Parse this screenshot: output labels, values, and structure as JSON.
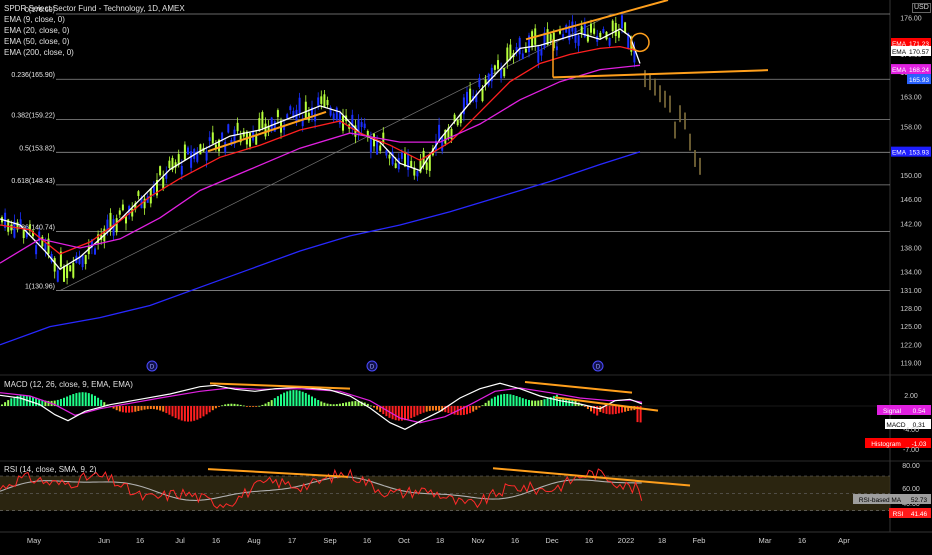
{
  "chart_data": {
    "type": "candlestick",
    "title": "SPDR Select Sector Fund - Technology, 1D, AMEX",
    "currency": "USD",
    "price_axis": {
      "ylim": [
        117.5,
        179
      ],
      "ticks": [
        "176.00",
        "170.00",
        "167.00",
        "163.00",
        "158.00",
        "154.00",
        "150.00",
        "146.00",
        "142.00",
        "138.00",
        "134.00",
        "131.00",
        "128.00",
        "125.00",
        "122.00",
        "119.00"
      ]
    },
    "time_axis": {
      "xlim": [
        0,
        932
      ],
      "labels": [
        {
          "label": "May",
          "x": 34
        },
        {
          "label": "Jun",
          "x": 104
        },
        {
          "label": "16",
          "x": 140
        },
        {
          "label": "Jul",
          "x": 180
        },
        {
          "label": "16",
          "x": 216
        },
        {
          "label": "Aug",
          "x": 254
        },
        {
          "label": "17",
          "x": 292
        },
        {
          "label": "Sep",
          "x": 330
        },
        {
          "label": "16",
          "x": 367
        },
        {
          "label": "Oct",
          "x": 404
        },
        {
          "label": "18",
          "x": 440
        },
        {
          "label": "Nov",
          "x": 478
        },
        {
          "label": "16",
          "x": 515
        },
        {
          "label": "Dec",
          "x": 552
        },
        {
          "label": "16",
          "x": 589
        },
        {
          "label": "2022",
          "x": 626
        },
        {
          "label": "18",
          "x": 662
        },
        {
          "label": "Feb",
          "x": 699
        },
        {
          "label": "Mar",
          "x": 765
        },
        {
          "label": "16",
          "x": 802
        },
        {
          "label": "Apr",
          "x": 844
        }
      ]
    },
    "fib_levels": [
      {
        "label": "0(176.69)",
        "value": 176.69
      },
      {
        "label": "0.236(165.90)",
        "value": 165.9
      },
      {
        "label": "0.382(159.22)",
        "value": 159.22
      },
      {
        "label": "0.5(153.82)",
        "value": 153.82
      },
      {
        "label": "0.618(148.43)",
        "value": 148.43
      },
      {
        "label": "0.786(140.74)",
        "value": 140.74
      },
      {
        "label": "1(130.96)",
        "value": 130.96
      }
    ],
    "ema_series": [
      {
        "name": "EMA (9, close, 0)",
        "color": "#ffffff",
        "points": [
          [
            0,
            142.8
          ],
          [
            20,
            141.8
          ],
          [
            45,
            137.5
          ],
          [
            60,
            134.5
          ],
          [
            80,
            136.5
          ],
          [
            110,
            141
          ],
          [
            140,
            146
          ],
          [
            170,
            151
          ],
          [
            200,
            154
          ],
          [
            230,
            156.5
          ],
          [
            260,
            157.5
          ],
          [
            290,
            159.5
          ],
          [
            320,
            161.5
          ],
          [
            340,
            160.5
          ],
          [
            360,
            157
          ],
          [
            380,
            155.5
          ],
          [
            400,
            152
          ],
          [
            420,
            150.8
          ],
          [
            440,
            156
          ],
          [
            460,
            160
          ],
          [
            480,
            164
          ],
          [
            500,
            167.5
          ],
          [
            520,
            171
          ],
          [
            540,
            171.5
          ],
          [
            560,
            172.5
          ],
          [
            580,
            173.5
          ],
          [
            600,
            172.5
          ],
          [
            620,
            174.2
          ],
          [
            630,
            173
          ],
          [
            640,
            168.5
          ]
        ]
      },
      {
        "name": "EMA (20, close, 0)",
        "color": "#ff2020",
        "points": [
          [
            0,
            141.8
          ],
          [
            30,
            141
          ],
          [
            60,
            137
          ],
          [
            90,
            139
          ],
          [
            120,
            142.5
          ],
          [
            150,
            146.5
          ],
          [
            180,
            149.5
          ],
          [
            220,
            153
          ],
          [
            260,
            155
          ],
          [
            300,
            157.5
          ],
          [
            340,
            159
          ],
          [
            360,
            157
          ],
          [
            390,
            155
          ],
          [
            420,
            152.5
          ],
          [
            450,
            155.5
          ],
          [
            480,
            160.5
          ],
          [
            510,
            165.5
          ],
          [
            540,
            168.5
          ],
          [
            570,
            170
          ],
          [
            600,
            171
          ],
          [
            620,
            171.3
          ],
          [
            640,
            170.5
          ]
        ]
      },
      {
        "name": "EMA (50, close, 0)",
        "color": "#e020e0",
        "points": [
          [
            0,
            135.5
          ],
          [
            40,
            139.5
          ],
          [
            80,
            138
          ],
          [
            120,
            139.5
          ],
          [
            160,
            143
          ],
          [
            200,
            147.5
          ],
          [
            250,
            151
          ],
          [
            300,
            154.5
          ],
          [
            350,
            157
          ],
          [
            400,
            155.5
          ],
          [
            440,
            155.5
          ],
          [
            480,
            158.5
          ],
          [
            520,
            162.5
          ],
          [
            560,
            165.5
          ],
          [
            600,
            167.5
          ],
          [
            640,
            168.2
          ]
        ]
      },
      {
        "name": "EMA (200, close, 0)",
        "color": "#2828ff",
        "points": [
          [
            0,
            122
          ],
          [
            50,
            125
          ],
          [
            100,
            126.5
          ],
          [
            150,
            128.5
          ],
          [
            200,
            131.5
          ],
          [
            250,
            134.5
          ],
          [
            300,
            137.5
          ],
          [
            350,
            140
          ],
          [
            400,
            141.8
          ],
          [
            450,
            144
          ],
          [
            500,
            146.5
          ],
          [
            550,
            149
          ],
          [
            600,
            151.8
          ],
          [
            640,
            153.9
          ]
        ]
      }
    ],
    "last_values": [
      {
        "label": "EMA",
        "value": "171.23",
        "color": "#ff0000",
        "text": "#ffffff"
      },
      {
        "label": "EMA",
        "value": "170.57",
        "color": "#ffffff",
        "text": "#000000"
      },
      {
        "label": "EMA",
        "value": "168.24",
        "color": "#e020e0",
        "text": "#ffffff"
      },
      {
        "label": "",
        "value": "165.93",
        "color": "#2962ff",
        "text": "#ffffff"
      },
      {
        "label": "EMA",
        "value": "153.93",
        "color": "#1e1eff",
        "text": "#ffffff"
      }
    ],
    "macd": {
      "legend": "MACD (12, 26, close, 9, EMA, EMA)",
      "ylim": [
        -7.8,
        4.2
      ],
      "ticks": [
        "2.00",
        "-4.00",
        "-7.00"
      ],
      "signal_label": "Signal",
      "signal_value": "0.54",
      "signal_color": "#e020e0",
      "macd_label": "MACD",
      "macd_value": "0.31",
      "macd_color": "#ffffff",
      "hist_label": "Histogram",
      "hist_value": "-1.03",
      "hist_color": "#ff0000"
    },
    "rsi": {
      "legend": "RSI (14, close, SMA, 9, 2)",
      "ylim": [
        10,
        85
      ],
      "ticks": [
        "80.00",
        "60.00",
        "40.00"
      ],
      "ma_label": "RSI-based MA",
      "ma_value": "52.73",
      "rsi_label": "RSI",
      "rsi_value": "41.46",
      "band": [
        30,
        70
      ]
    },
    "grid": true,
    "legend_position": "top-left"
  }
}
